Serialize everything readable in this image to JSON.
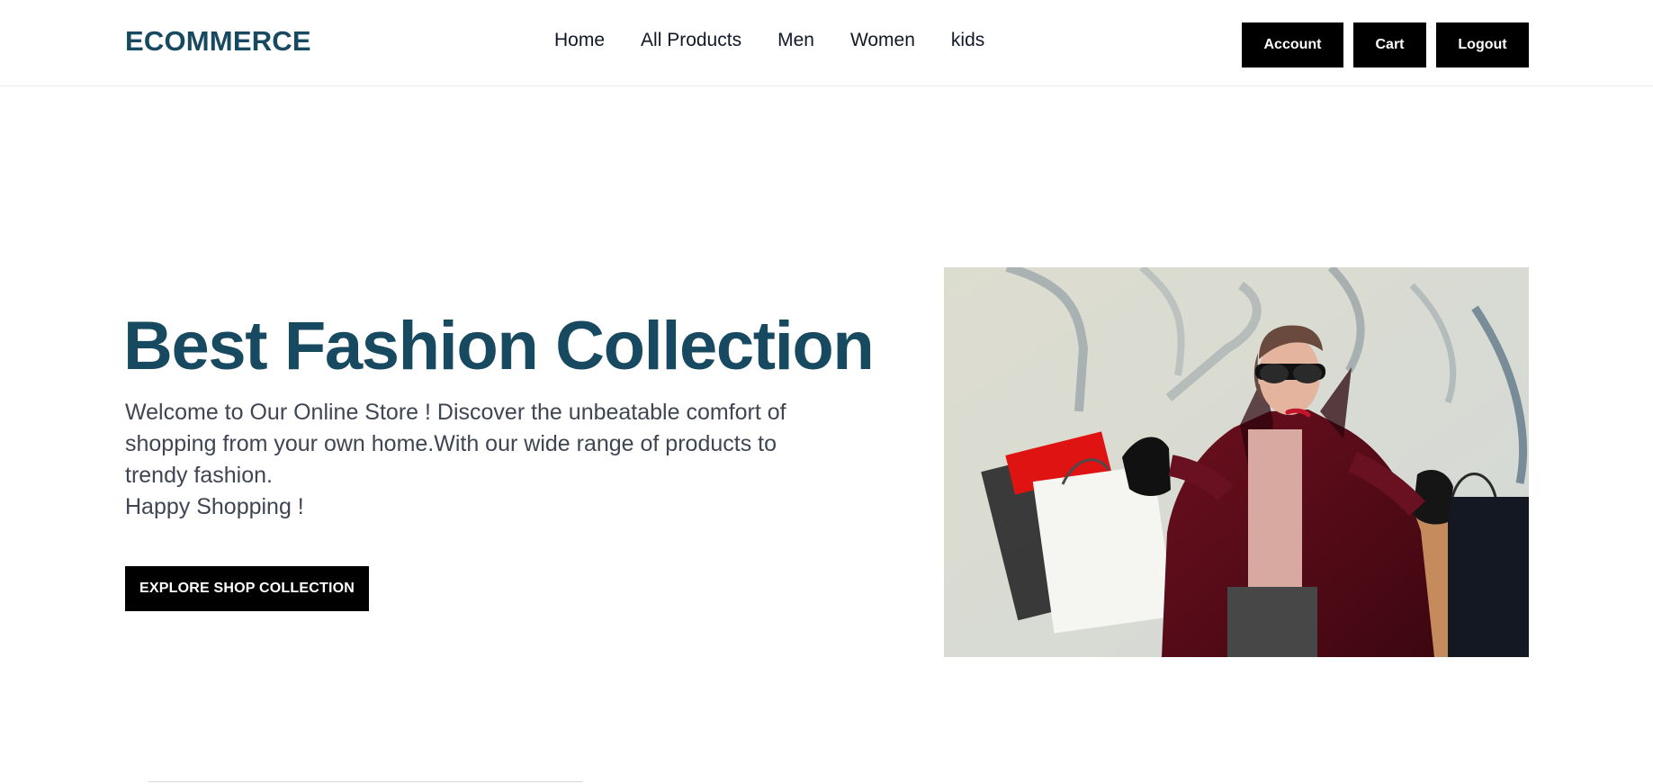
{
  "brand": {
    "name": "ECOMMERCE",
    "color": "#174a60"
  },
  "nav": {
    "items": [
      {
        "label": "Home"
      },
      {
        "label": "All Products"
      },
      {
        "label": "Men"
      },
      {
        "label": "Women"
      },
      {
        "label": "kids"
      }
    ]
  },
  "actions": {
    "account_label": "Account",
    "cart_label": "Cart",
    "logout_label": "Logout"
  },
  "hero": {
    "title": "Best Fashion Collection",
    "paragraph": "Welcome to Our Online Store ! Discover the unbeatable comfort of shopping from your own home.With our wide range of products to trendy fashion.",
    "tagline": "Happy Shopping !",
    "cta_label": "EXPLORE SHOP COLLECTION"
  },
  "colors": {
    "button_bg": "#000000",
    "button_text": "#ffffff",
    "heading": "#174a60",
    "body_text": "#3f4552"
  }
}
